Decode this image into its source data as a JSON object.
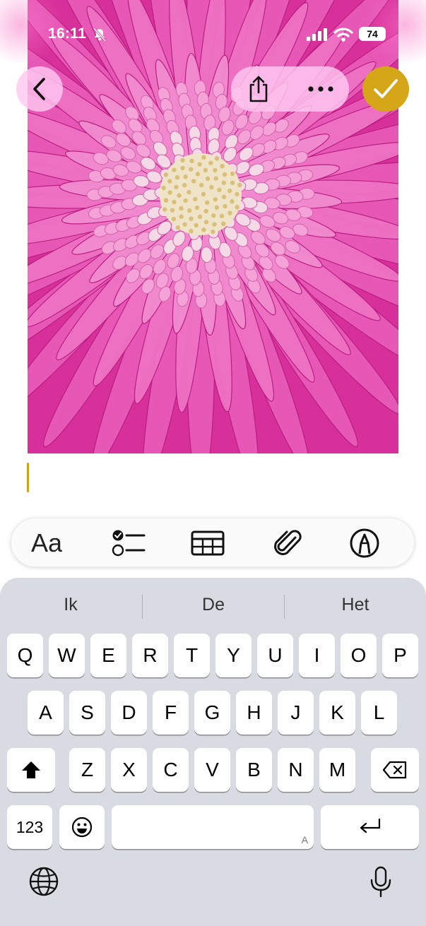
{
  "status_bar": {
    "time": "16:11",
    "battery": "74"
  },
  "top_bar": {
    "back_icon": "chevron-left-icon",
    "share_icon": "share-icon",
    "more_icon": "ellipsis-icon",
    "done_icon": "checkmark-icon"
  },
  "colors": {
    "accent": "#d5a617",
    "photo_pink": "#dc2f9a",
    "keyboard_bg": "#d8dbe1"
  },
  "toolbar": {
    "text_format_label": "Aa",
    "checklist_icon": "checklist-icon",
    "table_icon": "table-icon",
    "attachment_icon": "paperclip-icon",
    "markup_icon": "pen-circle-icon"
  },
  "keyboard": {
    "suggestions": [
      "Ik",
      "De",
      "Het"
    ],
    "row1": [
      "Q",
      "W",
      "E",
      "R",
      "T",
      "Y",
      "U",
      "I",
      "O",
      "P"
    ],
    "row2": [
      "A",
      "S",
      "D",
      "F",
      "G",
      "H",
      "J",
      "K",
      "L"
    ],
    "row3": [
      "Z",
      "X",
      "C",
      "V",
      "B",
      "N",
      "M"
    ],
    "numbers_label": "123",
    "space_hint": "A",
    "shift_icon": "shift-icon",
    "delete_icon": "delete-backward-icon",
    "return_icon": "return-icon",
    "emoji_icon": "emoji-icon",
    "globe_icon": "globe-icon",
    "mic_icon": "microphone-icon"
  }
}
